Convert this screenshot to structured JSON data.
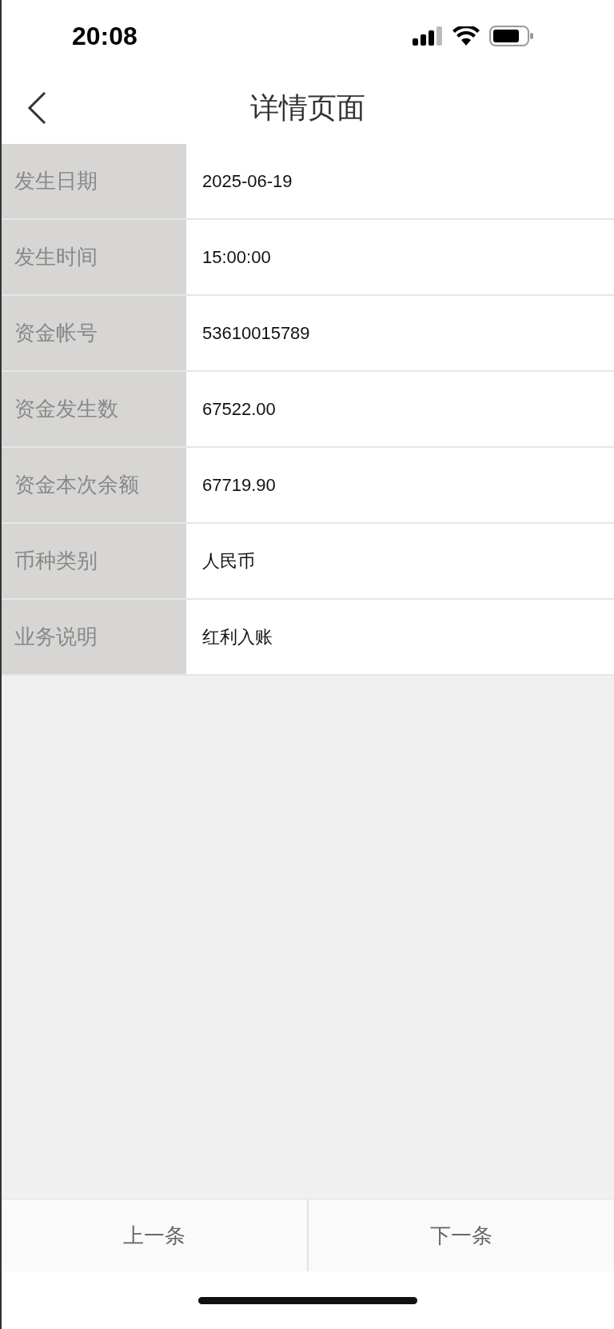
{
  "status_bar": {
    "time": "20:08"
  },
  "header": {
    "title": "详情页面"
  },
  "details": [
    {
      "label": "发生日期",
      "value": "2025-06-19"
    },
    {
      "label": "发生时间",
      "value": "15:00:00"
    },
    {
      "label": "资金帐号",
      "value": "53610015789"
    },
    {
      "label": "资金发生数",
      "value": "67522.00"
    },
    {
      "label": "资金本次余额",
      "value": "67719.90"
    },
    {
      "label": "币种类别",
      "value": "人民币"
    },
    {
      "label": "业务说明",
      "value": "红利入账"
    }
  ],
  "footer": {
    "buttons": [
      "上一条",
      "下一条"
    ]
  }
}
